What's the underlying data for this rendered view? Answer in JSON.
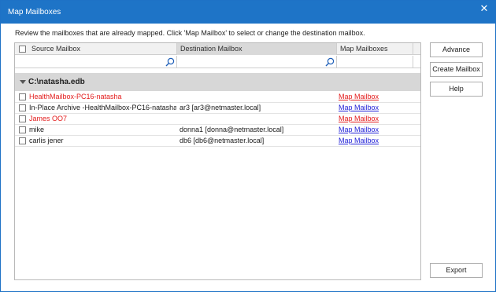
{
  "window": {
    "title": "Map Mailboxes",
    "close_glyph": "✕"
  },
  "instruction": "Review the mailboxes that are already mapped. Click 'Map Mailbox' to select or change the destination mailbox.",
  "columns": {
    "source": "Source Mailbox",
    "destination": "Destination Mailbox",
    "map": "Map Mailboxes"
  },
  "filter": {
    "icon": "search-icon"
  },
  "group": {
    "label": "C:\\natasha.edb"
  },
  "rows": [
    {
      "source": "HealthMailbox-PC16-natasha",
      "destination": "",
      "map": "Map Mailbox",
      "unmapped": true
    },
    {
      "source": "In-Place Archive -HealthMailbox-PC16-natasha",
      "destination": "ar3 [ar3@netmaster.local]",
      "map": "Map Mailbox",
      "unmapped": false
    },
    {
      "source": "James OO7",
      "destination": "",
      "map": "Map Mailbox",
      "unmapped": true
    },
    {
      "source": "mike",
      "destination": "donna1 [donna@netmaster.local]",
      "map": "Map Mailbox",
      "unmapped": false
    },
    {
      "source": "carlis jener",
      "destination": "db6 [db6@netmaster.local]",
      "map": "Map Mailbox",
      "unmapped": false
    }
  ],
  "buttons": {
    "advance": "Advance",
    "create_mailbox": "Create Mailbox",
    "help": "Help",
    "export": "Export"
  },
  "colors": {
    "titlebar": "#1e74c7",
    "unmapped_text": "#e31b1b",
    "link": "#1f1fd6"
  }
}
